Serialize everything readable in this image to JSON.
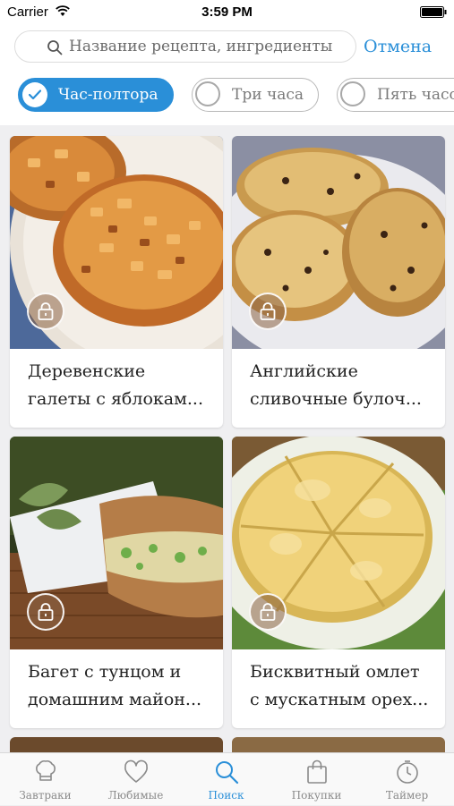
{
  "status_bar": {
    "carrier": "Carrier",
    "time": "3:59 PM"
  },
  "search": {
    "placeholder": "Название рецепта, ингредиенты",
    "cancel_label": "Отмена"
  },
  "filters": [
    {
      "label": "Час-полтора",
      "selected": true
    },
    {
      "label": "Три часа",
      "selected": false
    },
    {
      "label": "Пять часов",
      "selected": false
    }
  ],
  "recipes": [
    {
      "line1": "Деревенские",
      "line2": "галеты с яблокам...",
      "locked": true
    },
    {
      "line1": "Английские",
      "line2": "сливочные  булоч...",
      "locked": true
    },
    {
      "line1": "Багет с тунцом и",
      "line2": "домашним майон...",
      "locked": true
    },
    {
      "line1": "Бисквитный омлет",
      "line2": "с мускатным орех...",
      "locked": true
    }
  ],
  "tabs": [
    {
      "label": "Завтраки",
      "icon": "chef-hat-icon",
      "active": false
    },
    {
      "label": "Любимые",
      "icon": "heart-icon",
      "active": false
    },
    {
      "label": "Поиск",
      "icon": "search-icon",
      "active": true
    },
    {
      "label": "Покупки",
      "icon": "shopping-bag-icon",
      "active": false
    },
    {
      "label": "Таймер",
      "icon": "timer-icon",
      "active": false
    }
  ],
  "colors": {
    "accent": "#2a8fd8",
    "background": "#efeff1",
    "inactive": "#8a8a8a"
  }
}
